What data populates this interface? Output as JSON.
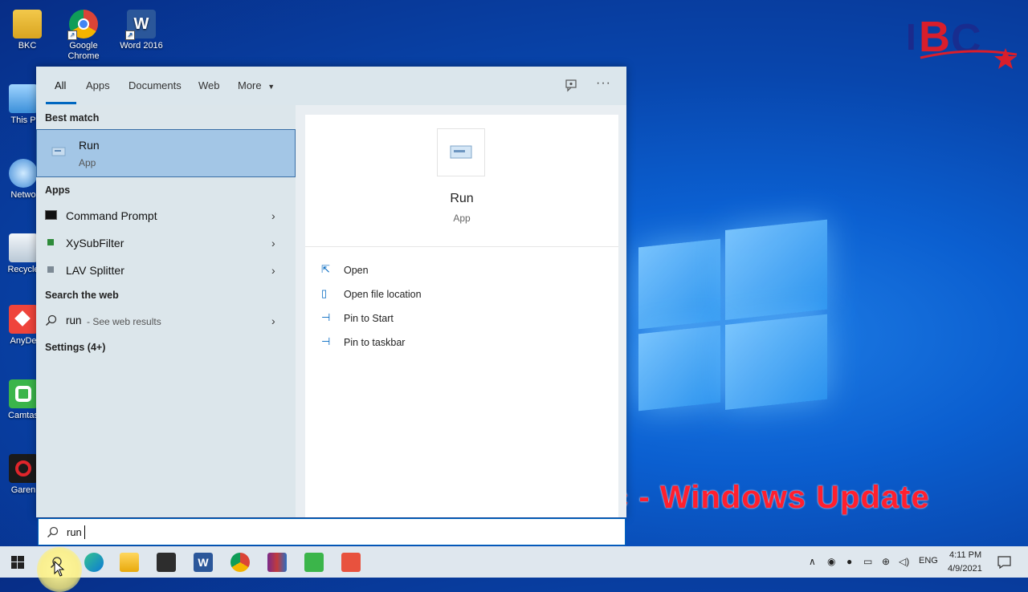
{
  "desktop": {
    "icons": [
      {
        "label": "BKC",
        "icon": "user-folder-icon"
      },
      {
        "label": "Google Chrome",
        "icon": "chrome-icon"
      },
      {
        "label": "Word 2016",
        "icon": "word-icon"
      },
      {
        "label": "This P",
        "icon": "this-pc-icon"
      },
      {
        "label": "Netwo",
        "icon": "network-icon"
      },
      {
        "label": "Recycle",
        "icon": "recycle-bin-icon"
      },
      {
        "label": "AnyDe",
        "icon": "anydesk-icon"
      },
      {
        "label": "Camtas",
        "icon": "camtasia-icon"
      },
      {
        "label": "Garen",
        "icon": "garena-icon"
      }
    ],
    "caption": "run - services.msc - Windows Update"
  },
  "search": {
    "tabs": [
      {
        "label": "All"
      },
      {
        "label": "Apps"
      },
      {
        "label": "Documents"
      },
      {
        "label": "Web"
      },
      {
        "label": "More"
      }
    ],
    "best_match_heading": "Best match",
    "best_match": {
      "title": "Run",
      "subtitle": "App"
    },
    "apps_heading": "Apps",
    "apps": [
      {
        "label": "Command Prompt"
      },
      {
        "label": "XySubFilter"
      },
      {
        "label": "LAV Splitter"
      }
    ],
    "web_heading": "Search the web",
    "web_result": {
      "term": "run",
      "suffix": " - See web results"
    },
    "settings_heading": "Settings (4+)",
    "detail": {
      "title": "Run",
      "subtitle": "App",
      "actions": [
        {
          "label": "Open",
          "icon": "open-icon"
        },
        {
          "label": "Open file location",
          "icon": "folder-location-icon"
        },
        {
          "label": "Pin to Start",
          "icon": "pin-icon"
        },
        {
          "label": "Pin to taskbar",
          "icon": "pin-icon"
        }
      ]
    },
    "query": "run"
  },
  "taskbar": {
    "language": "ENG",
    "time": "4:11 PM",
    "date": "4/9/2021"
  },
  "colors": {
    "accent": "#0067c0",
    "caption": "#ff1f2e"
  }
}
